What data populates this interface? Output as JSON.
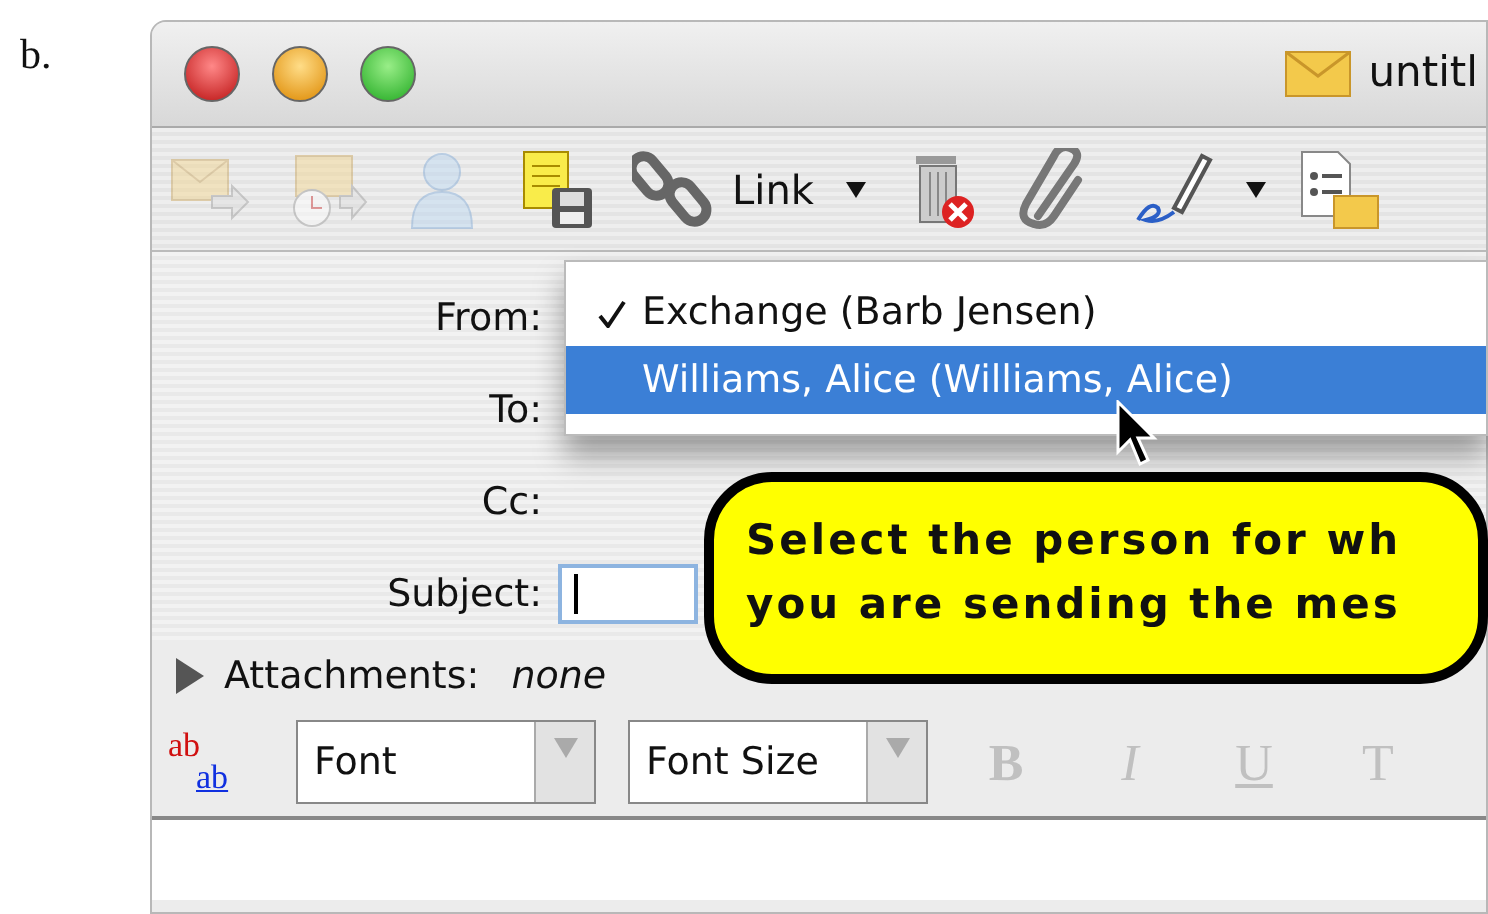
{
  "page_label": "b.",
  "window": {
    "title": "untitl"
  },
  "toolbar": [
    {
      "kind": "send",
      "disabled": true
    },
    {
      "kind": "send-later",
      "disabled": true
    },
    {
      "kind": "contact",
      "disabled": true
    },
    {
      "kind": "save-note",
      "disabled": false
    },
    {
      "kind": "link",
      "label": "Link",
      "has_menu": true,
      "disabled": false
    },
    {
      "kind": "delete",
      "disabled": false
    },
    {
      "kind": "attach",
      "disabled": false
    },
    {
      "kind": "signature",
      "has_menu": true,
      "disabled": false
    },
    {
      "kind": "checklist",
      "disabled": false
    }
  ],
  "header": {
    "labels": [
      "From:",
      "To:",
      "Cc:",
      "Subject:"
    ]
  },
  "from_menu": {
    "items": [
      {
        "label": "Exchange (Barb Jensen)",
        "checked": true,
        "selected": false
      },
      {
        "label": "Williams, Alice (Williams, Alice)",
        "checked": false,
        "selected": true
      }
    ]
  },
  "callout": {
    "lines": [
      "Select the person for wh",
      "you are sending the mes"
    ]
  },
  "attachments": {
    "label": "Attachments:",
    "value": "none",
    "expanded": false
  },
  "format_bar": {
    "icon_top": "ab",
    "icon_bottom": "ab",
    "font": "Font",
    "font_size": "Font Size",
    "styles": [
      {
        "label": "B",
        "kind": "bold",
        "disabled": true
      },
      {
        "label": "I",
        "kind": "italic",
        "disabled": true
      },
      {
        "label": "U",
        "kind": "underline",
        "disabled": true
      },
      {
        "label": "T",
        "kind": "plain",
        "disabled": true
      }
    ]
  }
}
